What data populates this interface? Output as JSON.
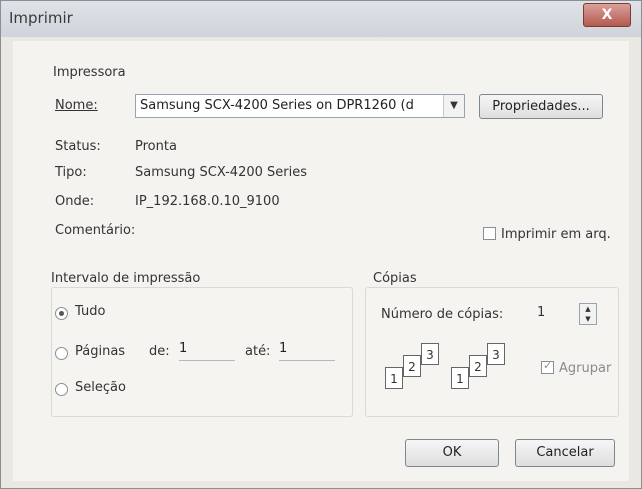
{
  "window": {
    "title": "Imprimir",
    "close_glyph": "X"
  },
  "printer": {
    "group_label": "Impressora",
    "name_label": "Nome:",
    "name_value": "Samsung SCX-4200 Series on DPR1260 (d",
    "properties_button": "Propriedades...",
    "status_label": "Status:",
    "status_value": "Pronta",
    "type_label": "Tipo:",
    "type_value": "Samsung SCX-4200 Series",
    "where_label": "Onde:",
    "where_value": "IP_192.168.0.10_9100",
    "comment_label": "Comentário:",
    "print_to_file_label": "Imprimir em arq.",
    "print_to_file_checked": false
  },
  "range": {
    "group_label": "Intervalo de impressão",
    "all_label": "Tudo",
    "pages_label": "Páginas",
    "from_label": "de:",
    "from_value": "1",
    "to_label": "até:",
    "to_value": "1",
    "selection_label": "Seleção",
    "selected_option": "all"
  },
  "copies": {
    "group_label": "Cópias",
    "count_label": "Número de cópias:",
    "count_value": "1",
    "collate_label": "Agrupar",
    "collate_checked": true,
    "collate_pages": [
      "1",
      "2",
      "3",
      "1",
      "2",
      "3"
    ]
  },
  "buttons": {
    "ok": "OK",
    "cancel": "Cancelar"
  }
}
